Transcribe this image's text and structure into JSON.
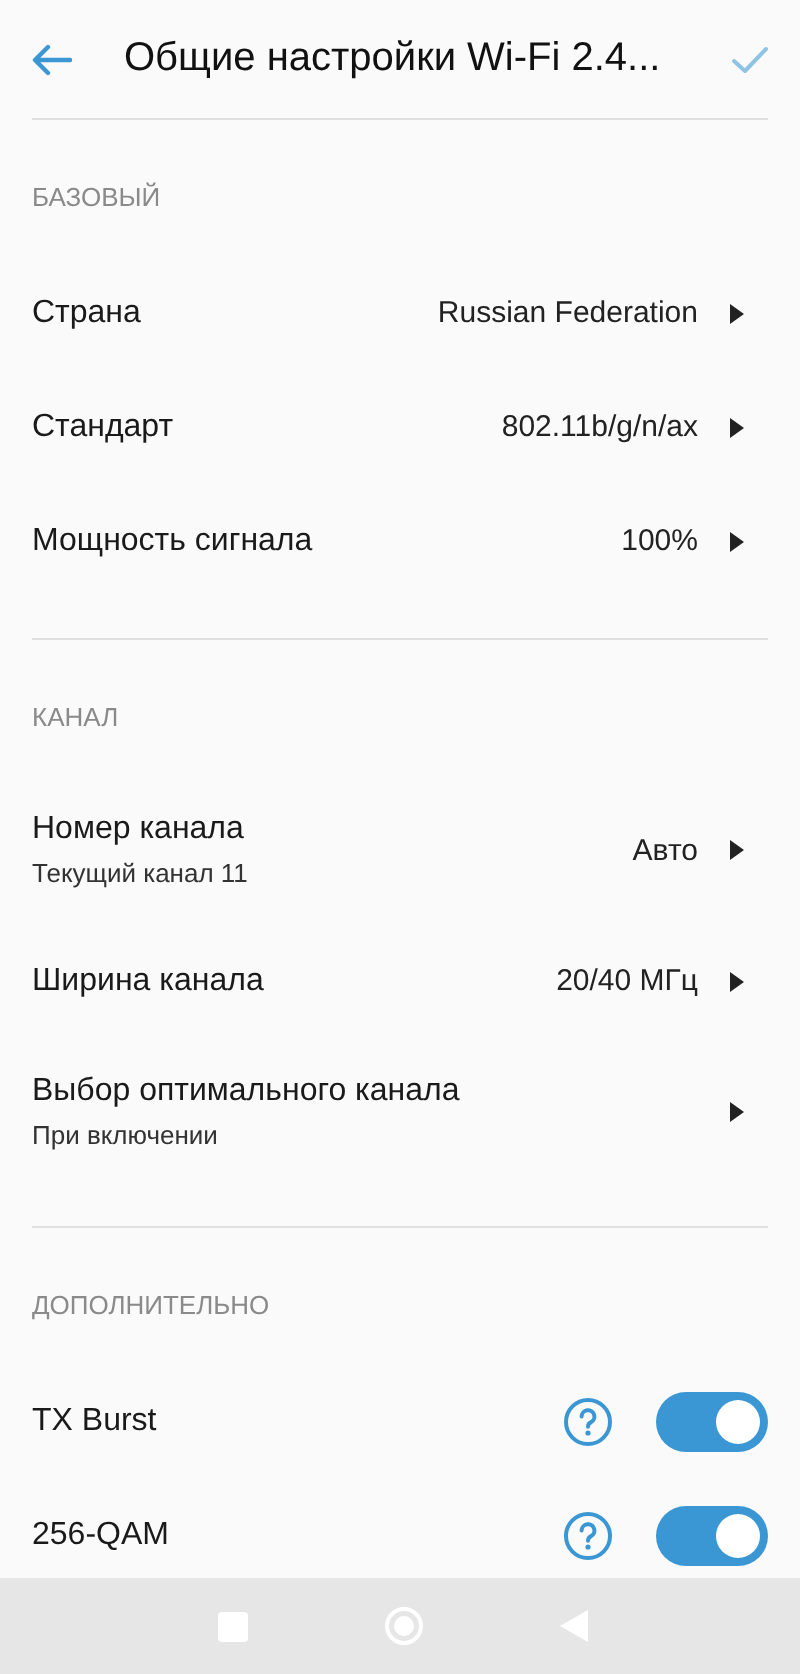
{
  "header": {
    "title": "Общие настройки Wi-Fi 2.4..."
  },
  "sections": [
    {
      "title": "БАЗОВЫЙ",
      "rows": [
        {
          "kind": "select",
          "label": "Страна",
          "value": "Russian Federation"
        },
        {
          "kind": "select",
          "label": "Стандарт",
          "value": "802.11b/g/n/ax"
        },
        {
          "kind": "select",
          "label": "Мощность сигнала",
          "value": "100%"
        }
      ]
    },
    {
      "title": "КАНАЛ",
      "rows": [
        {
          "kind": "select",
          "label": "Номер канала",
          "subtitle": "Текущий канал 11",
          "value": "Авто"
        },
        {
          "kind": "select",
          "label": "Ширина канала",
          "value": "20/40 МГц"
        },
        {
          "kind": "select",
          "label": "Выбор оптимального канала",
          "subtitle": "При включении"
        }
      ]
    },
    {
      "title": "ДОПОЛНИТЕЛЬНО",
      "rows": [
        {
          "kind": "toggle",
          "label": "TX Burst",
          "on": true
        },
        {
          "kind": "toggle",
          "label": "256-QAM",
          "on": true
        }
      ]
    }
  ]
}
